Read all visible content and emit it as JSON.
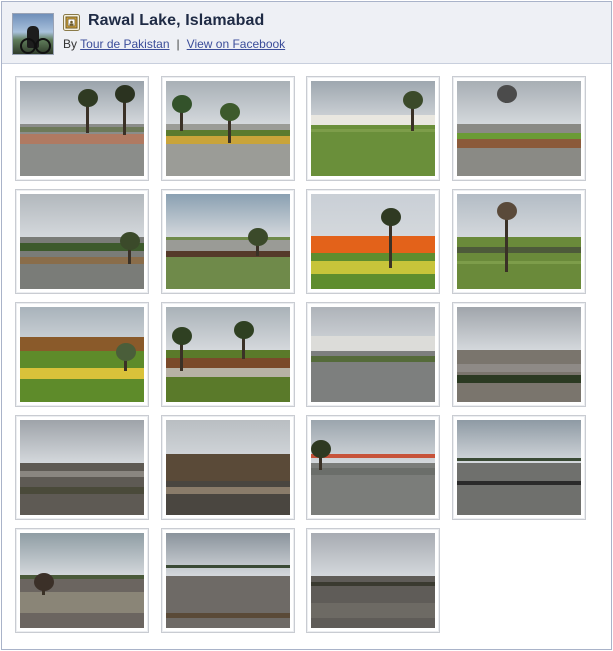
{
  "album": {
    "title": "Rawal Lake, Islamabad",
    "by_prefix": "By",
    "author_link": "Tour de Pakistan",
    "separator": "|",
    "facebook_link": "View on Facebook",
    "cover_icon": "album-cover-photo",
    "album_icon": "photo-album-icon"
  },
  "photos": [
    {
      "name": "lake-promenade-trees"
    },
    {
      "name": "garden-walkway-flowerbed"
    },
    {
      "name": "lawn-with-canopy-tent"
    },
    {
      "name": "round-flowerbed-pole"
    },
    {
      "name": "wet-terrace-planters"
    },
    {
      "name": "benches-terrace"
    },
    {
      "name": "orange-canna-flower"
    },
    {
      "name": "bare-tree-lawn"
    },
    {
      "name": "gazebo-flower-garden"
    },
    {
      "name": "wooden-bench-path"
    },
    {
      "name": "tent-pavilion-plaza"
    },
    {
      "name": "cloudy-lakeshore"
    },
    {
      "name": "cloudy-lake-view"
    },
    {
      "name": "thatched-hut-deck"
    },
    {
      "name": "paved-plaza-lake"
    },
    {
      "name": "ducks-on-lake"
    },
    {
      "name": "lake-shore-hut"
    },
    {
      "name": "lake-with-boat"
    },
    {
      "name": "rocky-lakeshore-sunset"
    }
  ],
  "colors": {
    "header_bg": "#eef0f5",
    "link": "#3b4d9a",
    "title": "#1f2b45",
    "frame_border": "#a9b3c9"
  }
}
